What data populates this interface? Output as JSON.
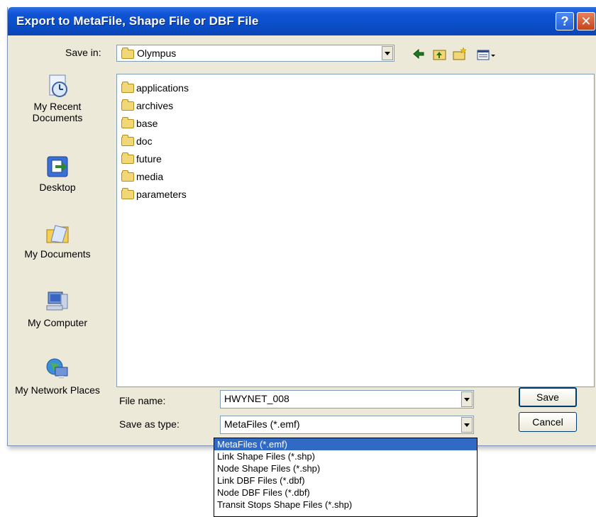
{
  "window": {
    "title": "Export to MetaFile, Shape File or DBF File",
    "help_glyph": "?",
    "close_glyph": "✕"
  },
  "save_in": {
    "label": "Save in:",
    "value": "Olympus"
  },
  "places": [
    {
      "label": "My Recent Documents",
      "icon": "recent-documents-icon"
    },
    {
      "label": "Desktop",
      "icon": "desktop-icon"
    },
    {
      "label": "My Documents",
      "icon": "my-documents-icon"
    },
    {
      "label": "My Computer",
      "icon": "my-computer-icon"
    },
    {
      "label": "My Network Places",
      "icon": "network-places-icon"
    }
  ],
  "files": [
    {
      "name": "applications",
      "icon": "folder-icon"
    },
    {
      "name": "archives",
      "icon": "folder-icon"
    },
    {
      "name": "base",
      "icon": "folder-icon"
    },
    {
      "name": "doc",
      "icon": "folder-icon"
    },
    {
      "name": "future",
      "icon": "folder-icon"
    },
    {
      "name": "media",
      "icon": "folder-icon"
    },
    {
      "name": "parameters",
      "icon": "folder-icon"
    }
  ],
  "file_name": {
    "label": "File name:",
    "value": "HWYNET_008"
  },
  "save_as_type": {
    "label": "Save as type:",
    "value": "MetaFiles (*.emf)",
    "options": [
      "MetaFiles (*.emf)",
      "Link Shape Files (*.shp)",
      "Node Shape Files (*.shp)",
      "Link DBF Files (*.dbf)",
      "Node DBF Files (*.dbf)",
      "Transit Stops Shape Files (*.shp)"
    ],
    "selected_index": 0
  },
  "buttons": {
    "save": "Save",
    "cancel": "Cancel"
  },
  "colors": {
    "titlebar": "#0a4ec8",
    "dialog_bg": "#ece9d8",
    "selection": "#316ac5"
  }
}
